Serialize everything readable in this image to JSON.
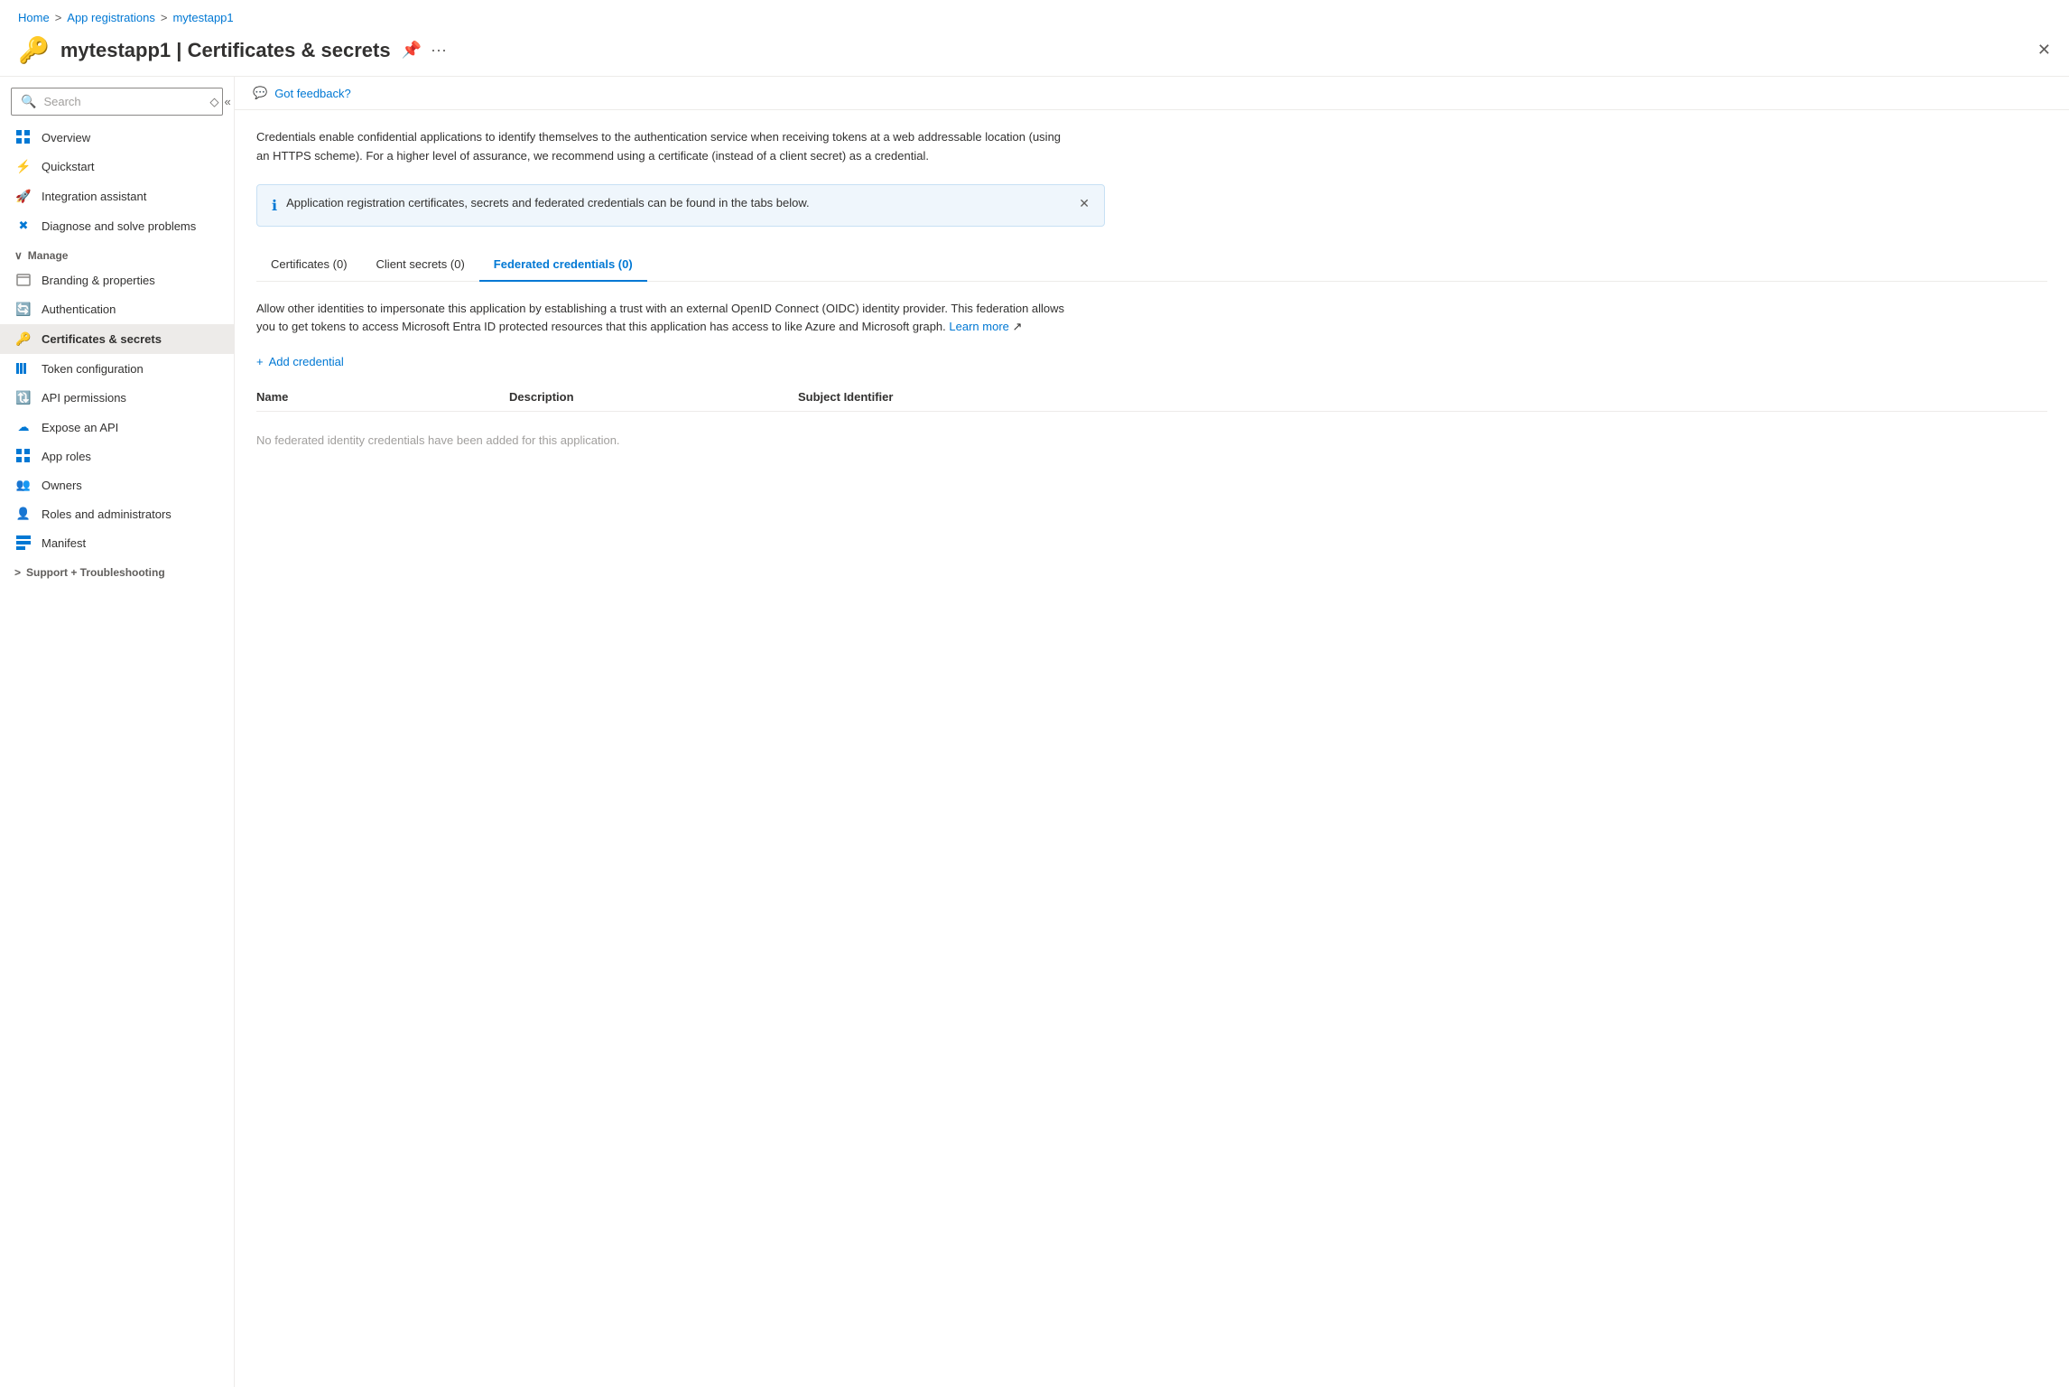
{
  "breadcrumb": {
    "home": "Home",
    "app_registrations": "App registrations",
    "app_name": "mytestapp1"
  },
  "header": {
    "icon": "🔑",
    "app_name": "mytestapp1",
    "separator": "|",
    "page_title": "Certificates & secrets",
    "pin_icon": "pin",
    "more_icon": "ellipsis",
    "close_icon": "close"
  },
  "sidebar": {
    "search_placeholder": "Search",
    "items": [
      {
        "id": "overview",
        "label": "Overview",
        "icon": "grid"
      },
      {
        "id": "quickstart",
        "label": "Quickstart",
        "icon": "quickstart"
      },
      {
        "id": "integration",
        "label": "Integration assistant",
        "icon": "rocket"
      },
      {
        "id": "diagnose",
        "label": "Diagnose and solve problems",
        "icon": "diagnose"
      },
      {
        "id": "manage-header",
        "label": "Manage",
        "type": "section"
      },
      {
        "id": "branding",
        "label": "Branding & properties",
        "icon": "branding"
      },
      {
        "id": "authentication",
        "label": "Authentication",
        "icon": "auth"
      },
      {
        "id": "certificates",
        "label": "Certificates & secrets",
        "icon": "cert",
        "active": true
      },
      {
        "id": "token",
        "label": "Token configuration",
        "icon": "token"
      },
      {
        "id": "api-permissions",
        "label": "API permissions",
        "icon": "api"
      },
      {
        "id": "expose-api",
        "label": "Expose an API",
        "icon": "expose"
      },
      {
        "id": "app-roles",
        "label": "App roles",
        "icon": "approles"
      },
      {
        "id": "owners",
        "label": "Owners",
        "icon": "owners"
      },
      {
        "id": "roles-admin",
        "label": "Roles and administrators",
        "icon": "roles"
      },
      {
        "id": "manifest",
        "label": "Manifest",
        "icon": "manifest"
      },
      {
        "id": "support-header",
        "label": "Support + Troubleshooting",
        "type": "section-expand"
      }
    ]
  },
  "feedback": {
    "icon": "feedback",
    "label": "Got feedback?"
  },
  "content": {
    "description": "Credentials enable confidential applications to identify themselves to the authentication service when receiving tokens at a web addressable location (using an HTTPS scheme). For a higher level of assurance, we recommend using a certificate (instead of a client secret) as a credential.",
    "info_banner": "Application registration certificates, secrets and federated credentials can be found in the tabs below.",
    "tabs": [
      {
        "id": "certificates",
        "label": "Certificates (0)",
        "active": false
      },
      {
        "id": "client-secrets",
        "label": "Client secrets (0)",
        "active": false
      },
      {
        "id": "federated",
        "label": "Federated credentials (0)",
        "active": true
      }
    ],
    "federated": {
      "description": "Allow other identities to impersonate this application by establishing a trust with an external OpenID Connect (OIDC) identity provider. This federation allows you to get tokens to access Microsoft Entra ID protected resources that this application has access to like Azure and Microsoft graph.",
      "learn_more_label": "Learn more",
      "add_credential_label": "Add credential",
      "table": {
        "columns": [
          {
            "id": "name",
            "label": "Name"
          },
          {
            "id": "description",
            "label": "Description"
          },
          {
            "id": "subject",
            "label": "Subject Identifier"
          }
        ],
        "empty_message": "No federated identity credentials have been added for this application."
      }
    }
  }
}
